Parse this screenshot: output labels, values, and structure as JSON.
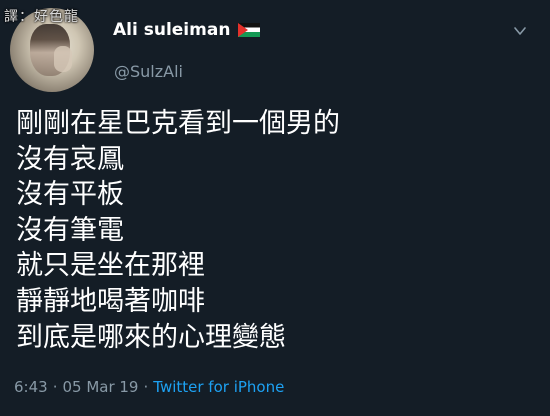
{
  "watermark": "譯：好色龍",
  "author": {
    "display_name": "Ali suleiman",
    "handle": "@SulzAli",
    "flag_icon": "palestine-flag-icon"
  },
  "tweet": {
    "lines": [
      "剛剛在星巴克看到一個男的",
      "沒有哀鳳",
      "沒有平板",
      "沒有筆電",
      "就只是坐在那裡",
      "靜靜地喝著咖啡",
      "到底是哪來的心理變態"
    ]
  },
  "meta": {
    "time": "6:43",
    "separator": "·",
    "date": "05 Mar 19",
    "source": "Twitter for iPhone"
  },
  "colors": {
    "background": "#141d26",
    "secondary_text": "#8899a6",
    "accent": "#1da1f2"
  }
}
